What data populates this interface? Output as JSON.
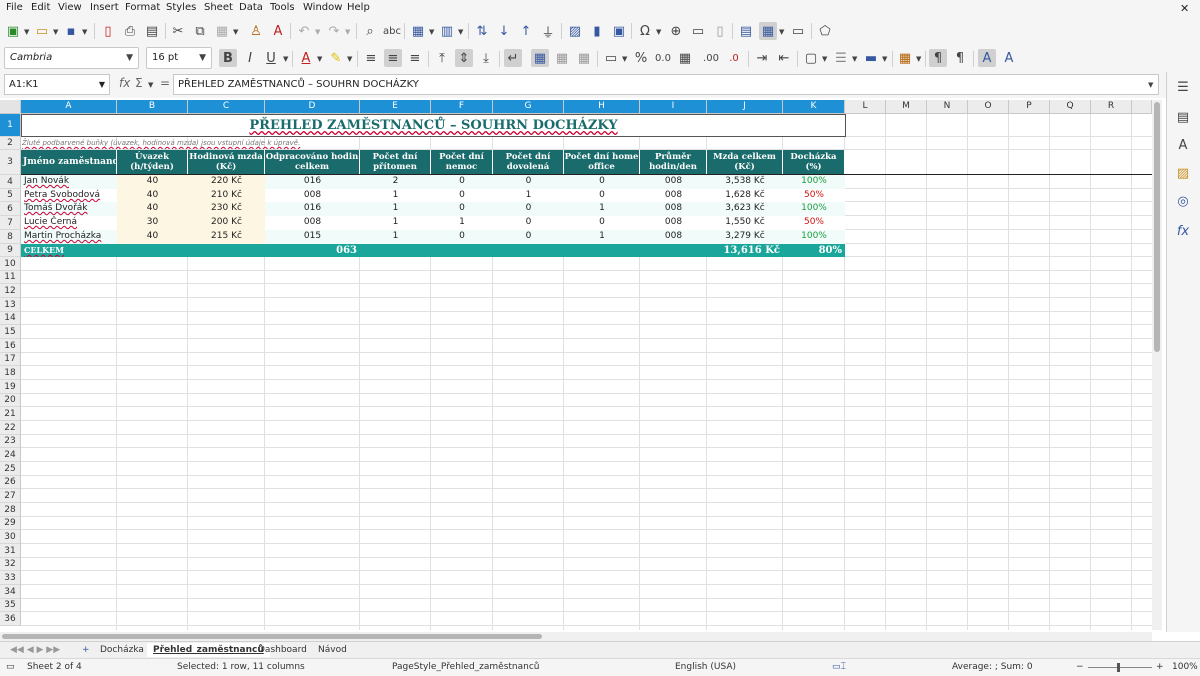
{
  "menu": [
    "File",
    "Edit",
    "View",
    "Insert",
    "Format",
    "Styles",
    "Sheet",
    "Data",
    "Tools",
    "Window",
    "Help"
  ],
  "toolbar": {
    "font_name": "Cambria",
    "font_size": "16 pt"
  },
  "formula_bar": {
    "name_box": "A1:K1",
    "content": "PŘEHLED ZAMĚSTNANCŮ – SOUHRN DOCHÁZKY"
  },
  "columns": [
    "A",
    "B",
    "C",
    "D",
    "E",
    "F",
    "G",
    "H",
    "I",
    "J",
    "K",
    "L",
    "M",
    "N",
    "O",
    "P",
    "Q",
    "R"
  ],
  "rows": [
    "1",
    "2",
    "3",
    "4",
    "5",
    "6",
    "7",
    "8",
    "9",
    "10",
    "11",
    "12",
    "13",
    "14",
    "15",
    "16",
    "17",
    "18",
    "19",
    "20",
    "21",
    "22",
    "23",
    "24",
    "25",
    "26",
    "27",
    "28",
    "29",
    "30",
    "31",
    "32",
    "33",
    "34",
    "35",
    "36"
  ],
  "sheet": {
    "title": "PŘEHLED ZAMĚSTNANCŮ – SOUHRN DOCHÁZKY",
    "note": "Žluté podbarvené buňky (úvazek, hodinová mzda) jsou vstupní údaje k úpravě.",
    "headers": [
      "Jméno zaměstnance",
      "Úvazek (h/týden)",
      "Hodinová mzda (Kč)",
      "Odpracováno hodin celkem",
      "Počet dní přítomen",
      "Počet dní nemoc",
      "Počet dní dovolená",
      "Počet dní home office",
      "Průměr hodin/den",
      "Mzda celkem (Kč)",
      "Docházka (%)"
    ],
    "data": [
      [
        "Jan Novák",
        "40",
        "220 Kč",
        "016",
        "2",
        "0",
        "0",
        "0",
        "008",
        "3,538 Kč",
        "100%"
      ],
      [
        "Petra Svobodová",
        "40",
        "210 Kč",
        "008",
        "1",
        "0",
        "1",
        "0",
        "008",
        "1,628 Kč",
        "50%"
      ],
      [
        "Tomáš Dvořák",
        "40",
        "230 Kč",
        "016",
        "1",
        "0",
        "0",
        "1",
        "008",
        "3,623 Kč",
        "100%"
      ],
      [
        "Lucie Černá",
        "30",
        "200 Kč",
        "008",
        "1",
        "1",
        "0",
        "0",
        "008",
        "1,550 Kč",
        "50%"
      ],
      [
        "Martin Procházka",
        "40",
        "215 Kč",
        "015",
        "1",
        "0",
        "0",
        "1",
        "008",
        "3,279 Kč",
        "100%"
      ]
    ],
    "attendance_status": [
      "good",
      "low",
      "good",
      "low",
      "good"
    ],
    "total_label": "CELKEM",
    "total_hours": "063",
    "total_wage": "13,616 Kč",
    "total_attendance": "80%"
  },
  "tabs": [
    "Docházka",
    "Přehled_zaměstnanců",
    "Dashboard",
    "Návod"
  ],
  "active_tab": "Přehled_zaměstnanců",
  "status": {
    "sheet": "Sheet 2 of 4",
    "selection": "Selected: 1 row, 11 columns",
    "page_style": "PageStyle_Přehled_zaměstnanců",
    "language": "English (USA)",
    "sum": "Average: ; Sum: 0",
    "zoom": "100%"
  },
  "colors": {
    "header_bg": "#1a6b6b",
    "total_bg": "#1aa69a",
    "input_bg": "#fdf6e3",
    "good": "#1a9e3a",
    "low": "#d01010",
    "selection": "#1e90d6"
  }
}
